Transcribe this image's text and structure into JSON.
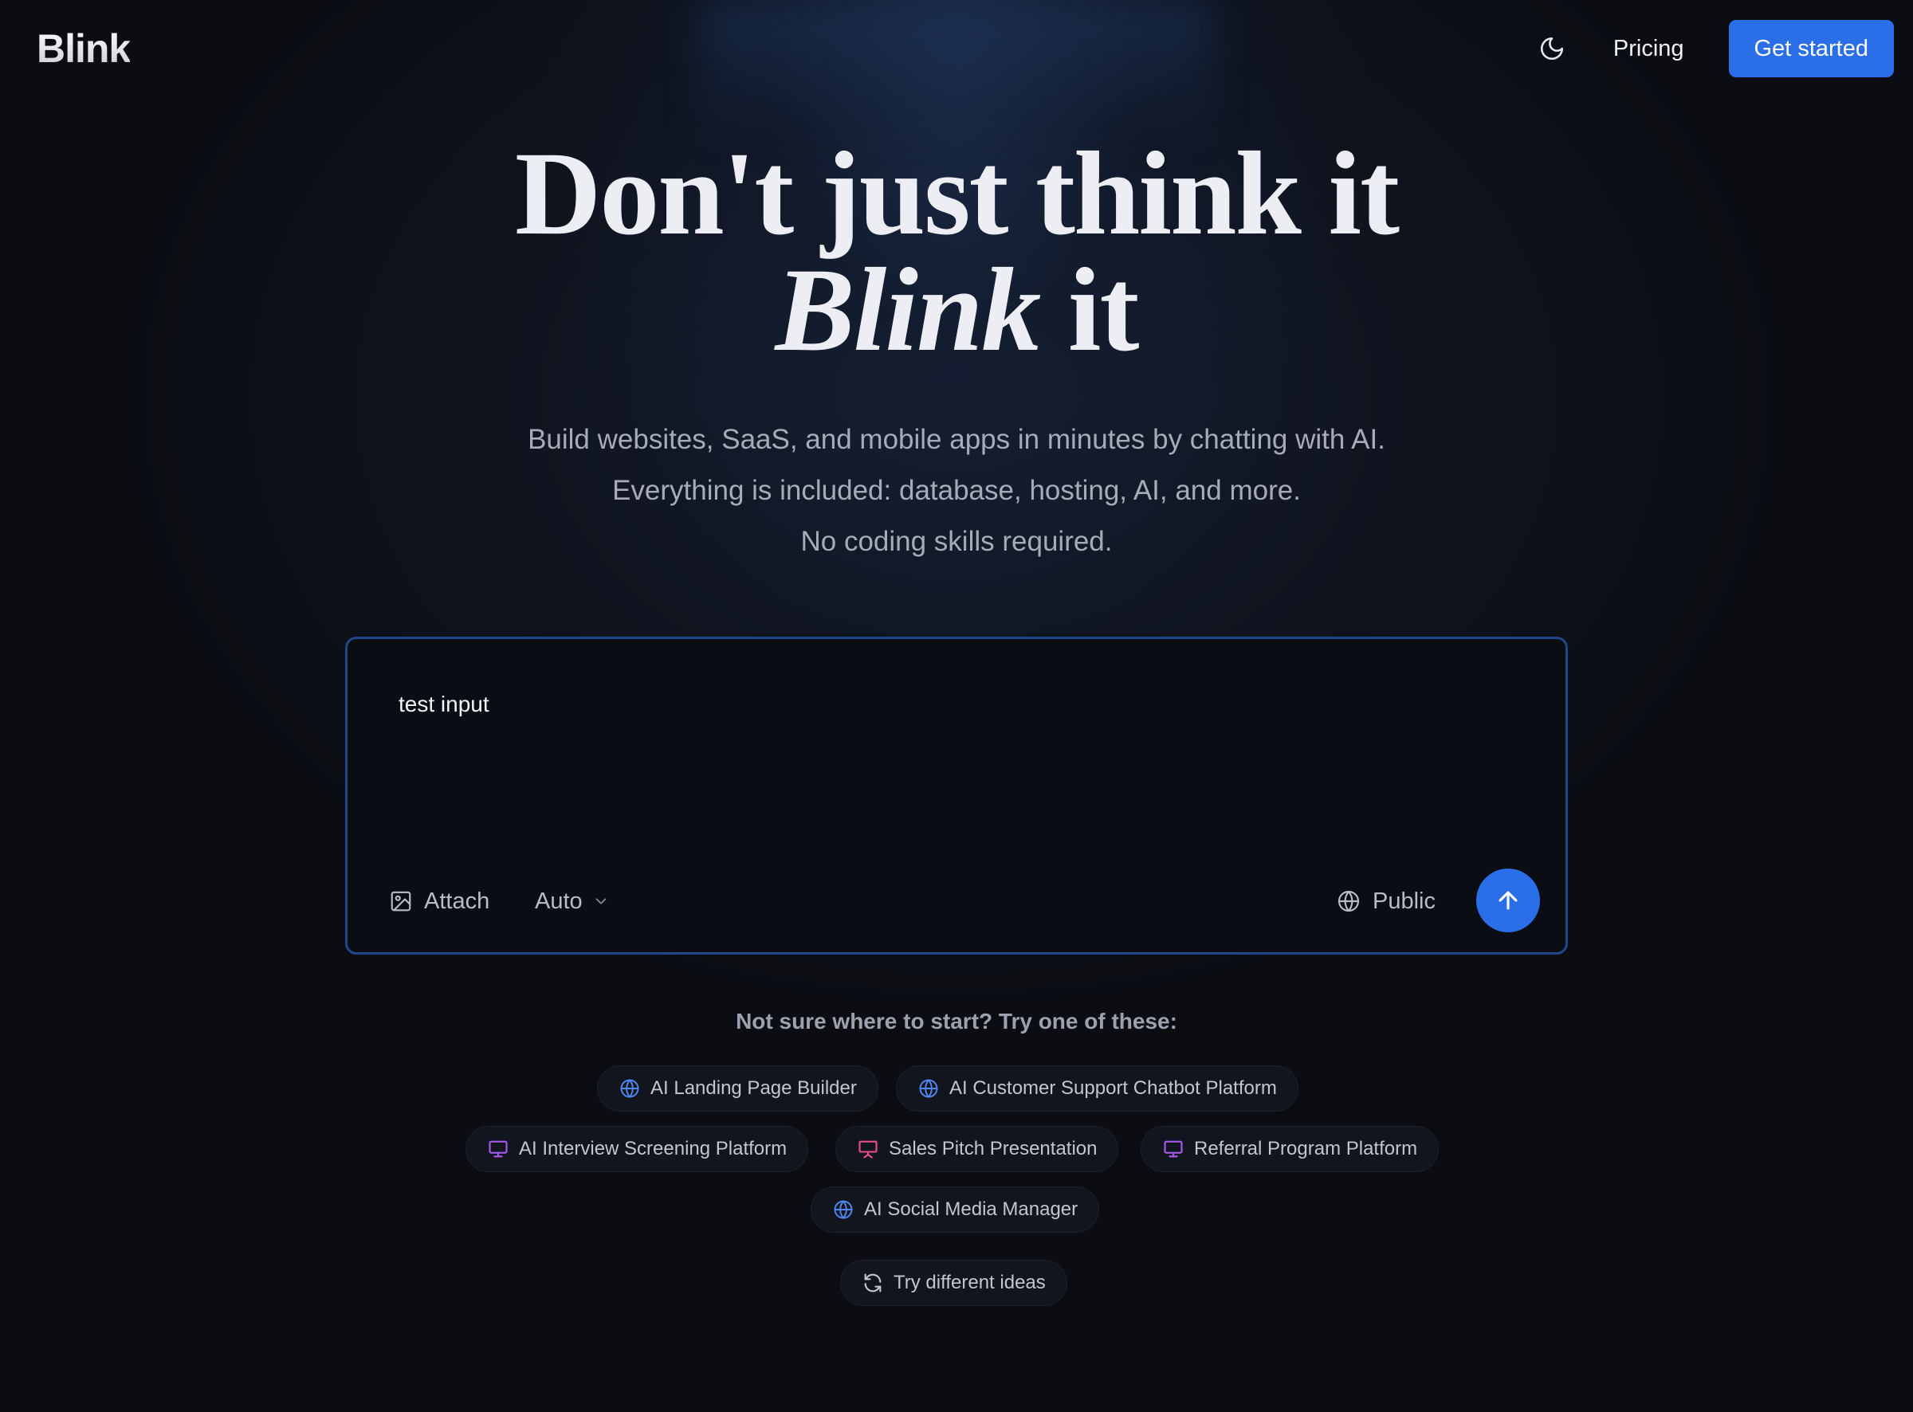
{
  "header": {
    "logo": "Blink",
    "theme_icon": "moon-icon",
    "pricing_label": "Pricing",
    "cta_label": "Get started"
  },
  "hero": {
    "title_line1": "Don't just think it",
    "title_line2_em": "Blink",
    "title_line2_rest": " it",
    "subtitle": [
      "Build websites, SaaS, and mobile apps in minutes by chatting with AI.",
      "Everything is included: database, hosting, AI, and more.",
      "No coding skills required."
    ]
  },
  "prompt": {
    "value": "test input",
    "attach_label": "Attach",
    "attach_icon": "image-icon",
    "model_label": "Auto",
    "visibility_label": "Public",
    "visibility_icon": "globe-icon",
    "send_icon": "arrow-up-icon"
  },
  "suggestions": {
    "heading": "Not sure where to start? Try one of these:",
    "chips": [
      {
        "label": "AI Landing Page Builder",
        "icon": "globe-icon"
      },
      {
        "label": "AI Customer Support Chatbot Platform",
        "icon": "globe-icon"
      },
      {
        "label": "AI Interview Screening Platform",
        "icon": "monitor-icon"
      },
      {
        "label": "Sales Pitch Presentation",
        "icon": "presentation-icon"
      },
      {
        "label": "Referral Program Platform",
        "icon": "monitor-icon"
      },
      {
        "label": "AI Social Media Manager",
        "icon": "globe-icon"
      }
    ],
    "refresh_label": "Try different ideas",
    "refresh_icon": "refresh-icon"
  },
  "colors": {
    "background": "#0b0d13",
    "accent": "#2a6ee8",
    "prompt_border": "#1f4789",
    "globe_icon": "#4f86f0",
    "monitor_icon": "#a45cf0",
    "presentation_icon": "#e8508a"
  }
}
